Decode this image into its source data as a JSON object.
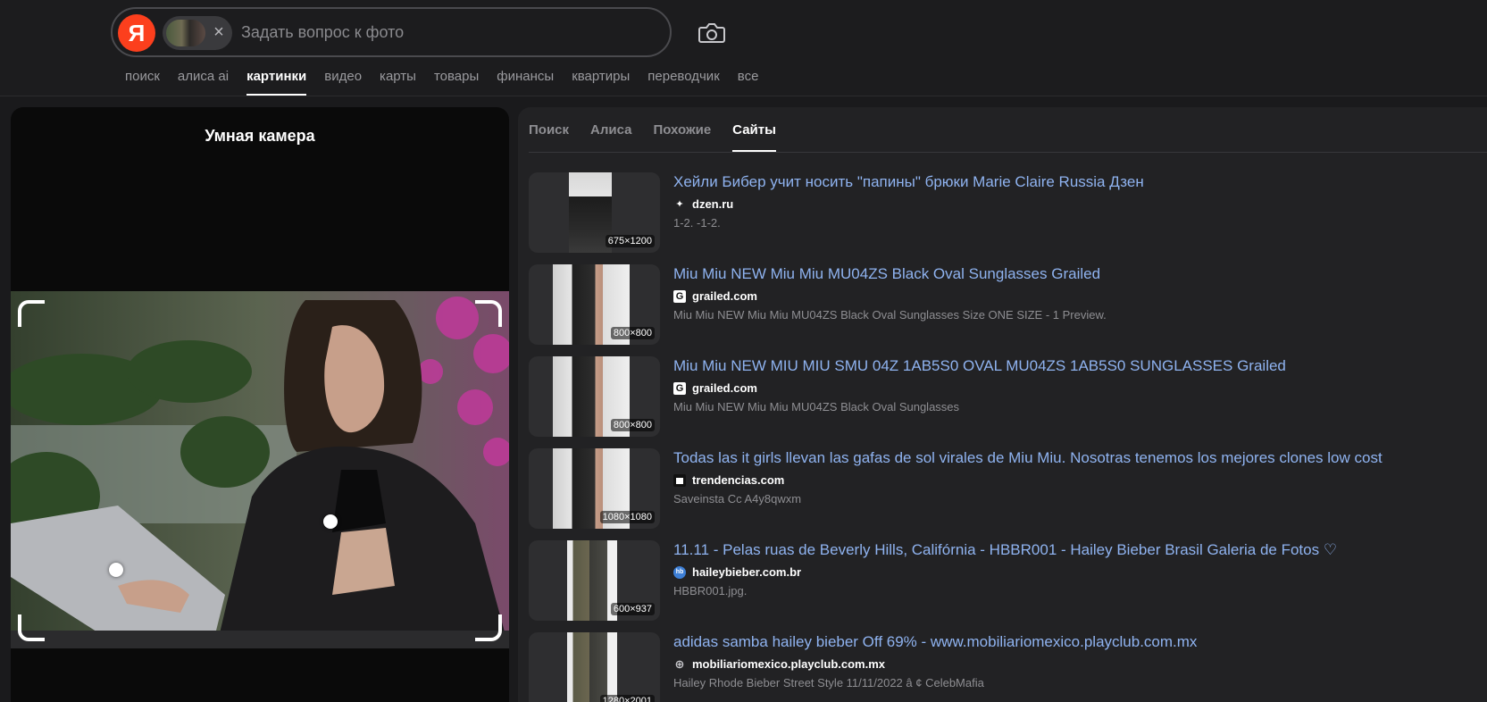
{
  "search": {
    "logo": "Я",
    "placeholder": "Задать вопрос к фото",
    "clear_icon": "close-icon",
    "camera_icon": "camera-icon"
  },
  "nav": {
    "items": [
      {
        "label": "поиск"
      },
      {
        "label": "алиса ai"
      },
      {
        "label": "картинки",
        "active": true
      },
      {
        "label": "видео"
      },
      {
        "label": "карты"
      },
      {
        "label": "товары"
      },
      {
        "label": "финансы"
      },
      {
        "label": "квартиры"
      },
      {
        "label": "переводчик"
      },
      {
        "label": "все"
      }
    ]
  },
  "left_panel": {
    "title": "Умная камера"
  },
  "tabs": [
    {
      "label": "Поиск"
    },
    {
      "label": "Алиса"
    },
    {
      "label": "Похожие"
    },
    {
      "label": "Сайты",
      "active": true
    }
  ],
  "results": [
    {
      "title": "Хейли Бибер учит носить \"папины\" брюки Marie Claire Russia Дзен",
      "domain": "dzen.ru",
      "favicon": "dzen-icon",
      "desc": "1-2. -1-2.",
      "size": "675×1200"
    },
    {
      "title": "Miu Miu NEW Miu Miu MU04ZS Black Oval Sunglasses Grailed",
      "domain": "grailed.com",
      "favicon": "G",
      "desc": "Miu Miu NEW Miu Miu MU04ZS Black Oval Sunglasses Size ONE SIZE - 1 Preview.",
      "size": "800×800"
    },
    {
      "title": "Miu Miu NEW MIU MIU SMU 04Z 1AB5S0 OVAL MU04ZS 1AB5S0 SUNGLASSES Grailed",
      "domain": "grailed.com",
      "favicon": "G",
      "desc": "Miu Miu NEW Miu Miu MU04ZS Black Oval Sunglasses",
      "size": "800×800"
    },
    {
      "title": "Todas las it girls llevan las gafas de sol virales de Miu Miu. Nosotras tenemos los mejores clones low cost",
      "domain": "trendencias.com",
      "favicon": "trendencias-icon",
      "desc": "Saveinsta Cc A4y8qwxm",
      "size": "1080×1080"
    },
    {
      "title": "11.11 - Pelas ruas de Beverly Hills, Califórnia - HBBR001 - Hailey Bieber Brasil Galeria de Fotos ♡",
      "domain": "haileybieber.com.br",
      "favicon": "hb-icon",
      "desc": "HBBR001.jpg.",
      "size": "600×937"
    },
    {
      "title": "adidas samba hailey bieber Off 69% - www.mobiliariomexico.playclub.com.mx",
      "domain": "mobiliariomexico.playclub.com.mx",
      "favicon": "globe-icon",
      "desc": "Hailey Rhode Bieber Street Style 11/11/2022 â ¢ CelebMafia",
      "size": "1280×2001"
    }
  ],
  "colors": {
    "background": "#1a1a1c",
    "panel": "#222224",
    "link": "#8fb3f0",
    "logo": "#fc3f1d"
  }
}
